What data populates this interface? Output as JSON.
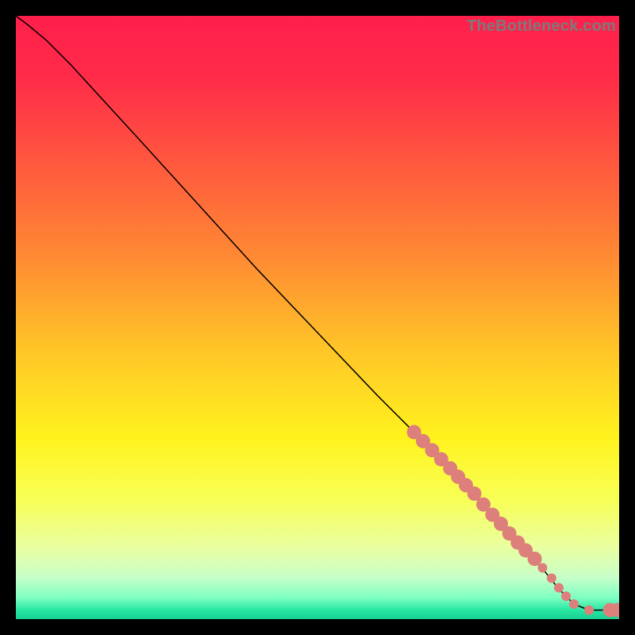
{
  "watermark": "TheBottleneck.com",
  "chart_data": {
    "type": "line",
    "title": "",
    "xlabel": "",
    "ylabel": "",
    "xlim": [
      0,
      100
    ],
    "ylim": [
      0,
      100
    ],
    "grid": false,
    "legend": false,
    "background_gradient": {
      "stops": [
        {
          "offset": 0.0,
          "color": "#ff1f4b"
        },
        {
          "offset": 0.1,
          "color": "#ff2b49"
        },
        {
          "offset": 0.25,
          "color": "#ff5a3e"
        },
        {
          "offset": 0.4,
          "color": "#ff8a33"
        },
        {
          "offset": 0.55,
          "color": "#ffc428"
        },
        {
          "offset": 0.7,
          "color": "#fff31e"
        },
        {
          "offset": 0.8,
          "color": "#f8ff55"
        },
        {
          "offset": 0.88,
          "color": "#eaffa0"
        },
        {
          "offset": 0.93,
          "color": "#c8ffc8"
        },
        {
          "offset": 0.965,
          "color": "#7dffc2"
        },
        {
          "offset": 0.985,
          "color": "#28e6a2"
        },
        {
          "offset": 1.0,
          "color": "#18cf92"
        }
      ]
    },
    "series": [
      {
        "name": "bottleneck-curve",
        "color": "#000000",
        "width": 1.5,
        "points": [
          {
            "x": 0.0,
            "y": 100.0
          },
          {
            "x": 2.0,
            "y": 98.5
          },
          {
            "x": 5.0,
            "y": 96.0
          },
          {
            "x": 9.0,
            "y": 92.0
          },
          {
            "x": 20.0,
            "y": 80.0
          },
          {
            "x": 40.0,
            "y": 58.0
          },
          {
            "x": 60.0,
            "y": 37.0
          },
          {
            "x": 70.0,
            "y": 27.0
          },
          {
            "x": 80.0,
            "y": 16.0
          },
          {
            "x": 86.0,
            "y": 10.0
          },
          {
            "x": 90.0,
            "y": 5.0
          },
          {
            "x": 92.5,
            "y": 2.5
          },
          {
            "x": 95.0,
            "y": 1.5
          },
          {
            "x": 99.0,
            "y": 1.5
          },
          {
            "x": 100.0,
            "y": 1.5
          }
        ]
      }
    ],
    "markers": {
      "name": "bottleneck-markers",
      "color": "#dd7f7a",
      "radius_large": 9,
      "radius_small": 6,
      "points": [
        {
          "x": 66.0,
          "y": 31.0,
          "r": "large"
        },
        {
          "x": 67.5,
          "y": 29.5,
          "r": "large"
        },
        {
          "x": 69.0,
          "y": 28.0,
          "r": "large"
        },
        {
          "x": 70.5,
          "y": 26.5,
          "r": "large"
        },
        {
          "x": 72.0,
          "y": 25.0,
          "r": "large"
        },
        {
          "x": 73.3,
          "y": 23.6,
          "r": "large"
        },
        {
          "x": 74.6,
          "y": 22.2,
          "r": "large"
        },
        {
          "x": 76.0,
          "y": 20.8,
          "r": "large"
        },
        {
          "x": 77.5,
          "y": 19.0,
          "r": "large"
        },
        {
          "x": 79.0,
          "y": 17.3,
          "r": "large"
        },
        {
          "x": 80.4,
          "y": 15.8,
          "r": "large"
        },
        {
          "x": 81.8,
          "y": 14.2,
          "r": "large"
        },
        {
          "x": 83.2,
          "y": 12.7,
          "r": "large"
        },
        {
          "x": 84.5,
          "y": 11.4,
          "r": "large"
        },
        {
          "x": 86.0,
          "y": 10.0,
          "r": "large"
        },
        {
          "x": 87.3,
          "y": 8.5,
          "r": "small"
        },
        {
          "x": 88.8,
          "y": 6.8,
          "r": "small"
        },
        {
          "x": 90.0,
          "y": 5.2,
          "r": "small"
        },
        {
          "x": 91.2,
          "y": 3.8,
          "r": "small"
        },
        {
          "x": 92.5,
          "y": 2.5,
          "r": "small"
        },
        {
          "x": 95.0,
          "y": 1.5,
          "r": "small"
        },
        {
          "x": 98.5,
          "y": 1.5,
          "r": "large"
        },
        {
          "x": 99.8,
          "y": 1.5,
          "r": "large"
        }
      ]
    }
  }
}
